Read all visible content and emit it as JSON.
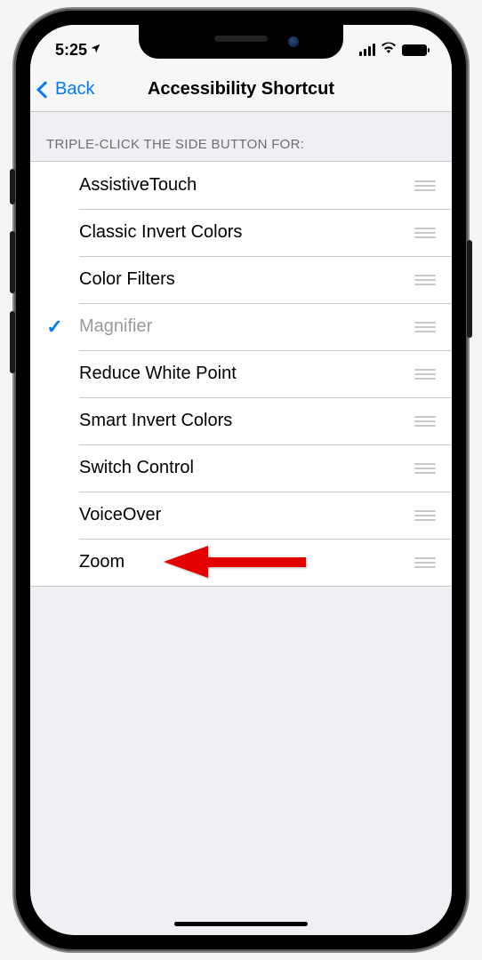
{
  "statusbar": {
    "time": "5:25"
  },
  "nav": {
    "back_label": "Back",
    "title": "Accessibility Shortcut"
  },
  "section": {
    "header": "TRIPLE-CLICK THE SIDE BUTTON FOR:",
    "items": [
      {
        "label": "AssistiveTouch",
        "selected": false
      },
      {
        "label": "Classic Invert Colors",
        "selected": false
      },
      {
        "label": "Color Filters",
        "selected": false
      },
      {
        "label": "Magnifier",
        "selected": true
      },
      {
        "label": "Reduce White Point",
        "selected": false
      },
      {
        "label": "Smart Invert Colors",
        "selected": false
      },
      {
        "label": "Switch Control",
        "selected": false
      },
      {
        "label": "VoiceOver",
        "selected": false
      },
      {
        "label": "Zoom",
        "selected": false
      }
    ]
  },
  "annotation": {
    "arrow_target": "Zoom"
  }
}
